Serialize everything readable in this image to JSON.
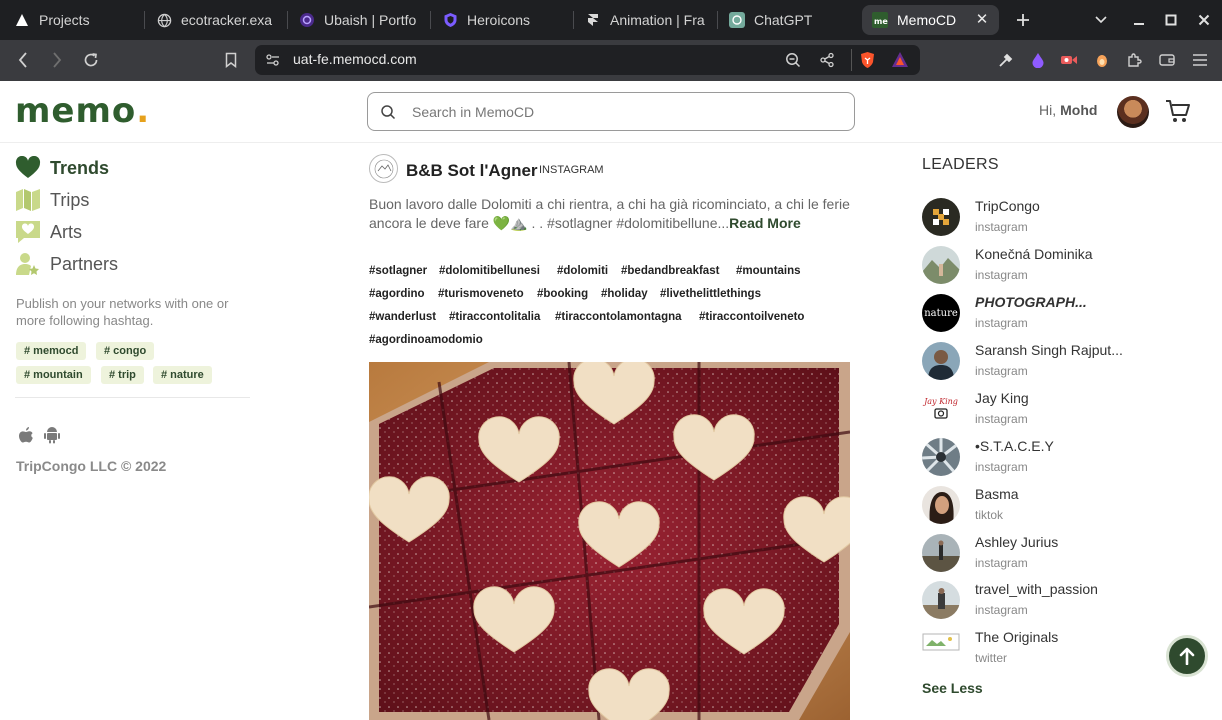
{
  "browser": {
    "tabs": [
      {
        "label": "Projects",
        "icon": "triangle-icon"
      },
      {
        "label": "ecotracker.exa",
        "icon": "globe-icon"
      },
      {
        "label": "Ubaish | Portfo",
        "icon": "portfolio-icon"
      },
      {
        "label": "Heroicons",
        "icon": "shield-icon"
      },
      {
        "label": "Animation | Fra",
        "icon": "framer-icon"
      },
      {
        "label": "ChatGPT",
        "icon": "chatgpt-icon"
      },
      {
        "label": "MemoCD",
        "icon": "memo-icon",
        "active": true
      }
    ],
    "url": "uat-fe.memocd.com"
  },
  "header": {
    "logo_text": "memo",
    "logo_dot": ".",
    "search_placeholder": "Search in MemoCD",
    "greeting": "Hi,",
    "user_name": "Mohd"
  },
  "sidebar": {
    "items": [
      {
        "label": "Trends",
        "icon": "heart-icon",
        "active": true
      },
      {
        "label": "Trips",
        "icon": "map-icon"
      },
      {
        "label": "Arts",
        "icon": "heart-message-icon"
      },
      {
        "label": "Partners",
        "icon": "partner-star-icon"
      }
    ],
    "note": "Publish on your networks with one or more following hashtag.",
    "tags": [
      "# memocd",
      "# congo",
      "# mountain",
      "# trip",
      "# nature"
    ],
    "copyright": "TripCongo LLC © 2022"
  },
  "post": {
    "title": "B&B Sot l'Agner",
    "source": "INSTAGRAM",
    "text": "Buon lavoro dalle Dolomiti a chi rientra, a chi ha già ricominciato, a chi le ferie ancora le deve fare 💚⛰️ . . #sotlagner #dolomitibellune...",
    "read_more": "Read More",
    "hashtags": [
      "#sotlagner",
      "#dolomitibellunesi",
      "#dolomiti",
      "#bedandbreakfast",
      "#mountains",
      "#agordino",
      "#turismoveneto",
      "#booking",
      "#holiday",
      "#livethelittlethings",
      "#wanderlust",
      "#tiraccontolitalia",
      "#tiraccontolamontagna",
      "#tiraccontoilveneto",
      "#agordinoamodomio"
    ]
  },
  "leaders": {
    "title": "LEADERS",
    "items": [
      {
        "name": "TripCongo",
        "network": "instagram"
      },
      {
        "name": "Konečná Dominika",
        "network": "instagram"
      },
      {
        "name": "PHOTOGRAPH...",
        "network": "instagram"
      },
      {
        "name": "Saransh Singh Rajput...",
        "network": "instagram"
      },
      {
        "name": "Jay King",
        "network": "instagram"
      },
      {
        "name": "•S.T.A.C.E.Y",
        "network": "instagram"
      },
      {
        "name": "Basma",
        "network": "tiktok"
      },
      {
        "name": "Ashley Jurius",
        "network": "instagram"
      },
      {
        "name": "travel_with_passion",
        "network": "instagram"
      },
      {
        "name": "The Originals",
        "network": "twitter"
      }
    ],
    "see_less": "See Less",
    "nature_badge": "nature",
    "jay_badge": "Jay King"
  },
  "colors": {
    "brand_green": "#2f4a2e",
    "logo_green": "#2f5d2e",
    "accent_orange": "#e6a11c",
    "chip_bg": "#eef3dc"
  }
}
